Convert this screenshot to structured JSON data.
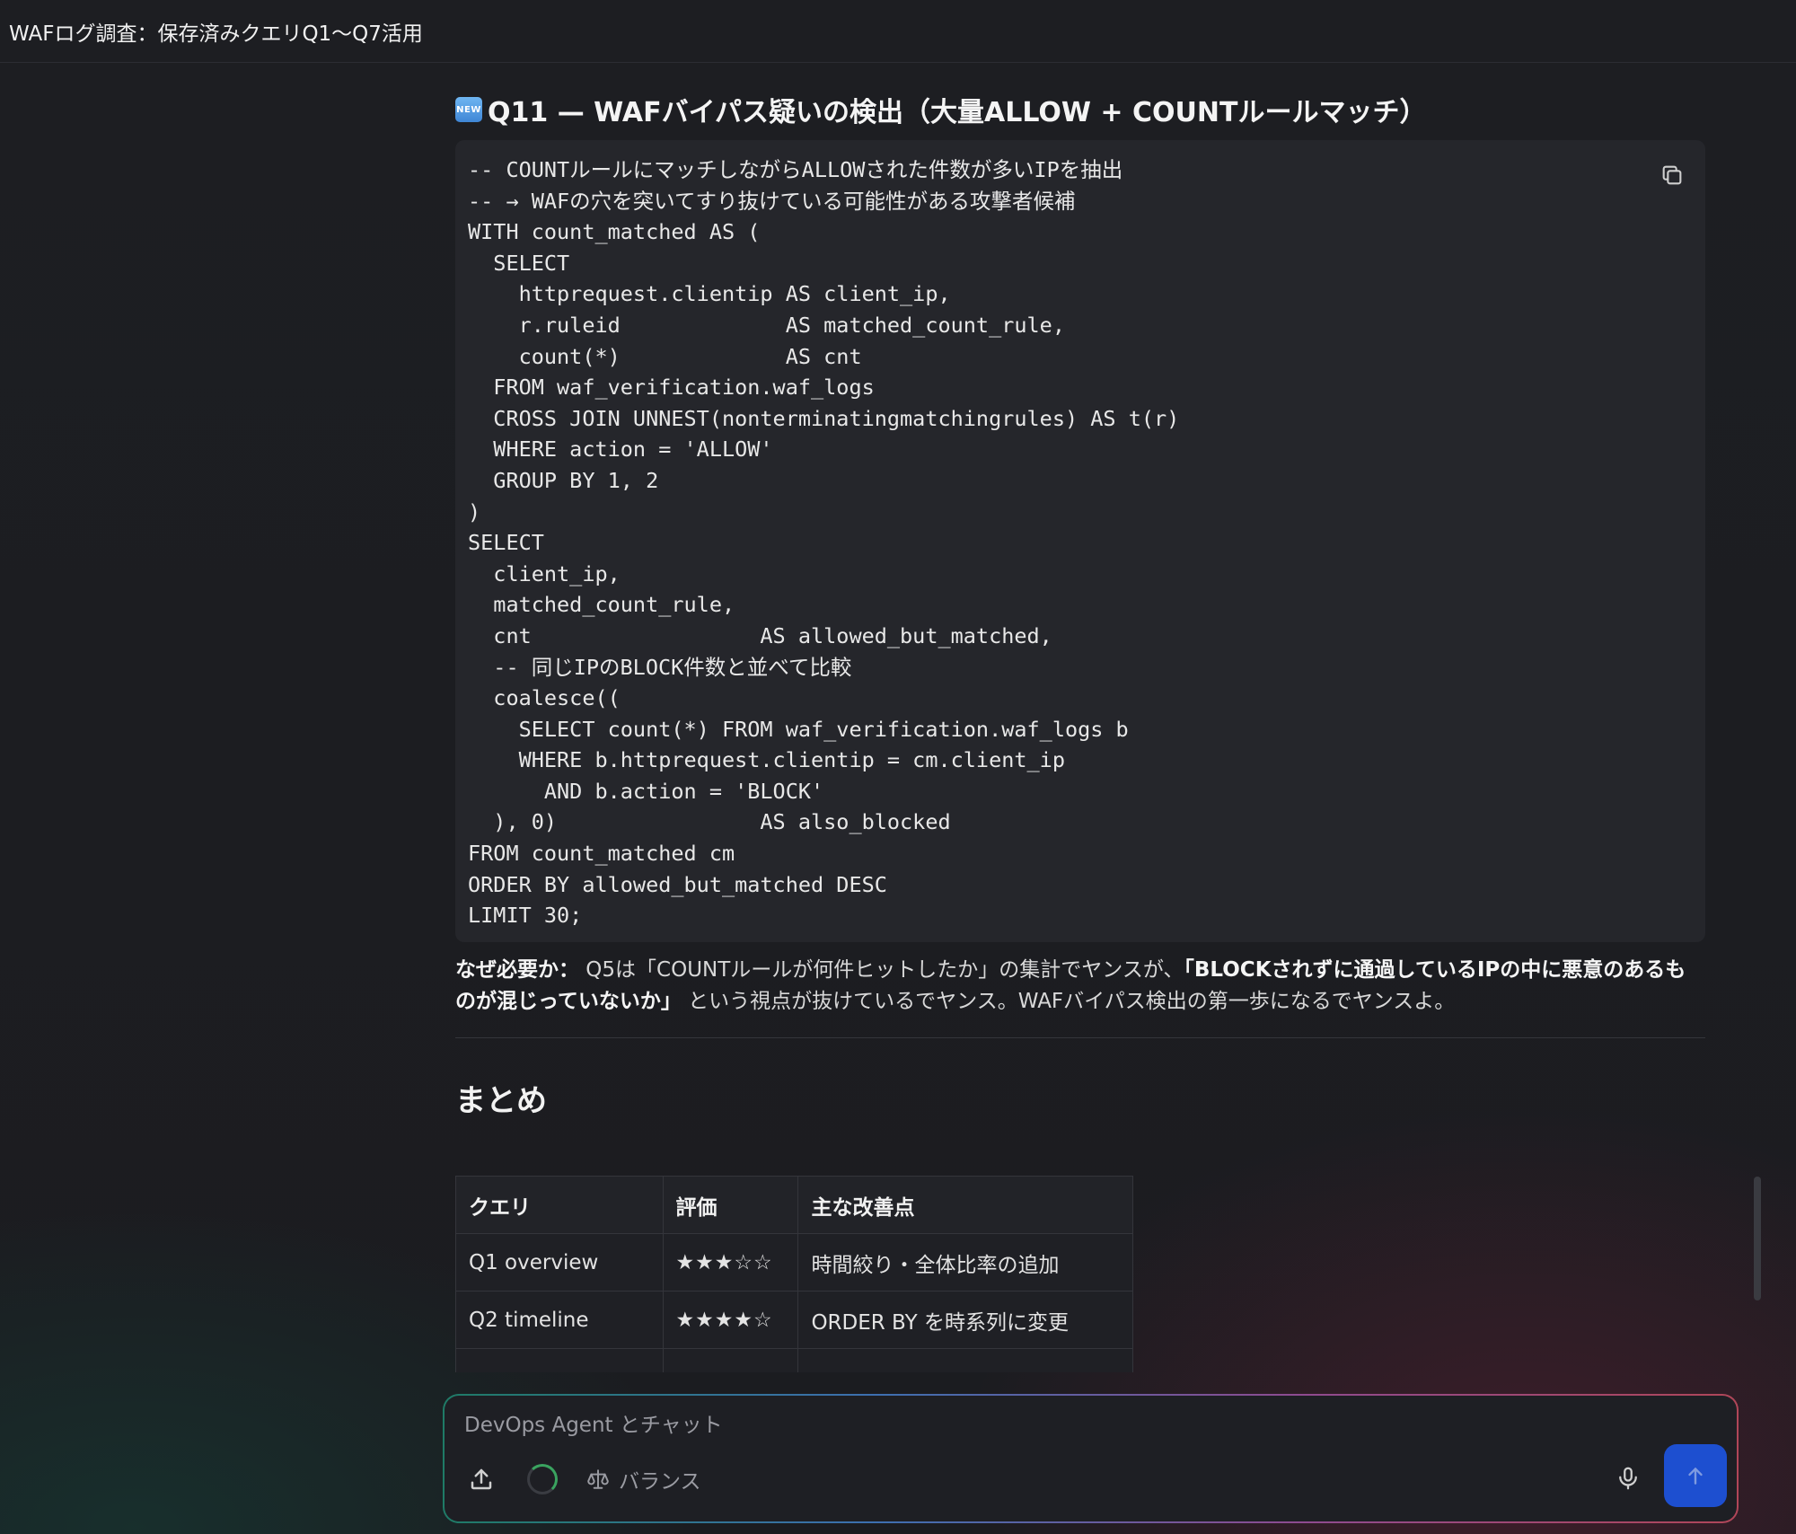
{
  "window": {
    "title": "WAFログ調査：保存済みクエリQ1〜Q7活用"
  },
  "section": {
    "badge": "NEW",
    "heading": "Q11 — WAFバイパス疑いの検出（大量ALLOW + COUNTルールマッチ）",
    "code": "-- COUNTルールにマッチしながらALLOWされた件数が多いIPを抽出\n-- → WAFの穴を突いてすり抜けている可能性がある攻撃者候補\nWITH count_matched AS (\n  SELECT\n    httprequest.clientip AS client_ip,\n    r.ruleid             AS matched_count_rule,\n    count(*)             AS cnt\n  FROM waf_verification.waf_logs\n  CROSS JOIN UNNEST(nonterminatingmatchingrules) AS t(r)\n  WHERE action = 'ALLOW'\n  GROUP BY 1, 2\n)\nSELECT\n  client_ip,\n  matched_count_rule,\n  cnt                  AS allowed_but_matched,\n  -- 同じIPのBLOCK件数と並べて比較\n  coalesce((\n    SELECT count(*) FROM waf_verification.waf_logs b\n    WHERE b.httprequest.clientip = cm.client_ip\n      AND b.action = 'BLOCK'\n  ), 0)                AS also_blocked\nFROM count_matched cm\nORDER BY allowed_but_matched DESC\nLIMIT 30;",
    "why_label": "なぜ必要か：",
    "why_text_1": " Q5は「COUNTルールが何件ヒットしたか」の集計でヤンスが、",
    "why_bold": "「BLOCKされずに通過しているIPの中に悪意のあるものが混じっていないか」",
    "why_text_2": " という視点が抜けているでヤンス。WAFバイパス検出の第一歩になるでヤンスよ。"
  },
  "summary": {
    "heading": "まとめ",
    "columns": [
      "クエリ",
      "評価",
      "主な改善点"
    ],
    "rows": [
      {
        "query": "Q1 overview",
        "rating_text": "★★★☆☆",
        "rating": 3,
        "improvement": "時間絞り・全体比率の追加"
      },
      {
        "query": "Q2 timeline",
        "rating_text": "★★★★☆",
        "rating": 4,
        "improvement": "ORDER BY を時系列に変更"
      }
    ]
  },
  "chat": {
    "placeholder": "DevOps Agent とチャット",
    "mode_label": "バランス"
  },
  "colors": {
    "background": "#1e1f24",
    "code_background": "#25262b",
    "send_button": "#1d4fd0",
    "spinner_accent": "#3aa35f"
  },
  "icons": [
    "new-badge-icon",
    "copy-icon",
    "upload-icon",
    "loading-spinner-icon",
    "balance-scale-icon",
    "microphone-icon",
    "arrow-up-icon"
  ]
}
